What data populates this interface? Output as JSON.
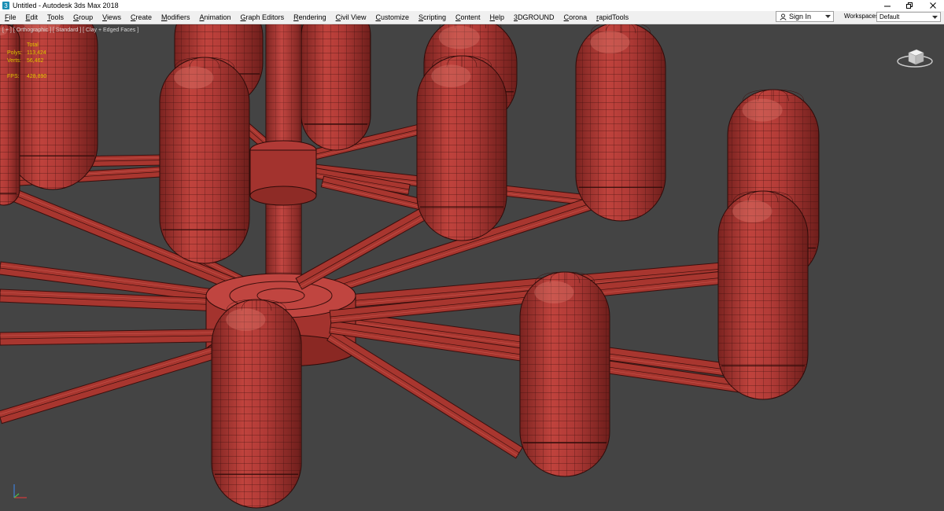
{
  "window": {
    "title": "Untitled - Autodesk 3ds Max 2018"
  },
  "menubar": {
    "items": [
      {
        "label": "File"
      },
      {
        "label": "Edit"
      },
      {
        "label": "Tools"
      },
      {
        "label": "Group"
      },
      {
        "label": "Views"
      },
      {
        "label": "Create"
      },
      {
        "label": "Modifiers"
      },
      {
        "label": "Animation"
      },
      {
        "label": "Graph Editors"
      },
      {
        "label": "Rendering"
      },
      {
        "label": "Civil View"
      },
      {
        "label": "Customize"
      },
      {
        "label": "Scripting"
      },
      {
        "label": "Content"
      },
      {
        "label": "Help"
      },
      {
        "label": "3DGROUND"
      },
      {
        "label": "Corona"
      },
      {
        "label": "rapidTools"
      }
    ],
    "signin_label": "Sign In",
    "workspaces_label": "Workspaces:",
    "workspace_value": "Default"
  },
  "viewport": {
    "label": "[ + ] [ Orthographic ] [ Standard ] [ Clay + Edged Faces ]",
    "stats": {
      "header": "Total",
      "polys_label": "Polys:",
      "polys_value": "113,424",
      "verts_label": "Verts:",
      "verts_value": "56,462",
      "fps_label": "FPS:",
      "fps_value": "428,890"
    }
  },
  "icons": {
    "app": "3dsmax-app-icon",
    "minimize": "minimize-icon",
    "restore": "restore-icon",
    "close": "close-icon",
    "user": "user-icon",
    "dropdown": "chevron-down-icon",
    "viewcube": "viewcube-icon",
    "axis": "axis-tripod-icon"
  },
  "colors": {
    "viewport_bg": "#444444",
    "clay_red": "#b03a36",
    "stats_yellow": "#e3c500"
  }
}
